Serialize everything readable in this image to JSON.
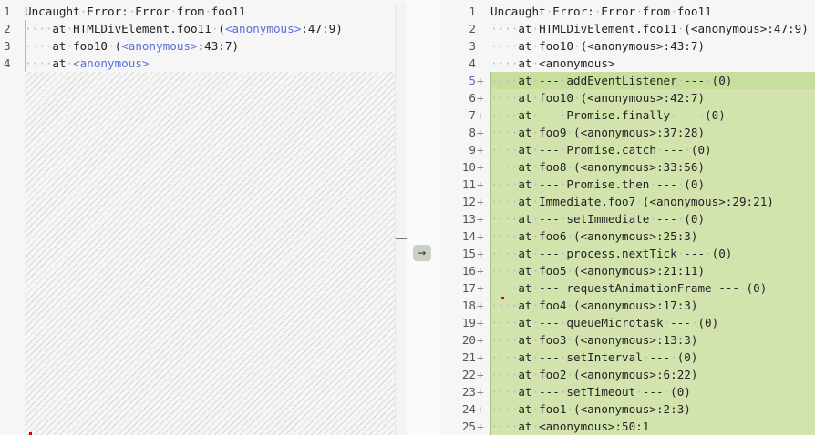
{
  "left": {
    "lines": [
      {
        "num": "1",
        "parts": [
          {
            "t": "Uncaught Error: Error from foo11"
          }
        ]
      },
      {
        "num": "2",
        "parts": [
          {
            "t": "    at HTMLDivElement.foo11 ("
          },
          {
            "t": "<anonymous>",
            "c": "anon"
          },
          {
            "t": ":47:9)"
          }
        ]
      },
      {
        "num": "3",
        "parts": [
          {
            "t": "    at foo10 ("
          },
          {
            "t": "<anonymous>",
            "c": "anon"
          },
          {
            "t": ":43:7)"
          }
        ]
      },
      {
        "num": "4",
        "parts": [
          {
            "t": "    at "
          },
          {
            "t": "<anonymous>",
            "c": "anon"
          }
        ]
      }
    ]
  },
  "middle": {
    "arrow_icon": "→"
  },
  "right": {
    "lines": [
      {
        "num": "1",
        "text": "Uncaught Error: Error from foo11"
      },
      {
        "num": "2",
        "text": "    at HTMLDivElement.foo11 (<anonymous>:47:9)"
      },
      {
        "num": "3",
        "text": "    at foo10 (<anonymous>:43:7)"
      },
      {
        "num": "4",
        "text": "    at <anonymous>"
      },
      {
        "num": "5",
        "added": true,
        "text": "    at --- addEventListener --- (0)"
      },
      {
        "num": "6",
        "added": true,
        "text": "    at foo10 (<anonymous>:42:7)"
      },
      {
        "num": "7",
        "added": true,
        "text": "    at --- Promise.finally --- (0)"
      },
      {
        "num": "8",
        "added": true,
        "text": "    at foo9 (<anonymous>:37:28)"
      },
      {
        "num": "9",
        "added": true,
        "text": "    at --- Promise.catch --- (0)"
      },
      {
        "num": "10",
        "added": true,
        "text": "    at foo8 (<anonymous>:33:56)"
      },
      {
        "num": "11",
        "added": true,
        "text": "    at --- Promise.then --- (0)"
      },
      {
        "num": "12",
        "added": true,
        "text": "    at Immediate.foo7 (<anonymous>:29:21)"
      },
      {
        "num": "13",
        "added": true,
        "text": "    at --- setImmediate --- (0)"
      },
      {
        "num": "14",
        "added": true,
        "text": "    at foo6 (<anonymous>:25:3)"
      },
      {
        "num": "15",
        "added": true,
        "text": "    at --- process.nextTick --- (0)"
      },
      {
        "num": "16",
        "added": true,
        "text": "    at foo5 (<anonymous>:21:11)"
      },
      {
        "num": "17",
        "added": true,
        "text": "    at --- requestAnimationFrame --- (0)"
      },
      {
        "num": "18",
        "added": true,
        "text": "    at foo4 (<anonymous>:17:3)"
      },
      {
        "num": "19",
        "added": true,
        "text": "    at --- queueMicrotask --- (0)"
      },
      {
        "num": "20",
        "added": true,
        "text": "    at foo3 (<anonymous>:13:3)"
      },
      {
        "num": "21",
        "added": true,
        "text": "    at --- setInterval --- (0)"
      },
      {
        "num": "22",
        "added": true,
        "text": "    at foo2 (<anonymous>:6:22)"
      },
      {
        "num": "23",
        "added": true,
        "text": "    at --- setTimeout --- (0)"
      },
      {
        "num": "24",
        "added": true,
        "text": "    at foo1 (<anonymous>:2:3)"
      },
      {
        "num": "25",
        "added": true,
        "text": "    at <anonymous>:50:1"
      }
    ],
    "plus_marker": "+"
  },
  "colors": {
    "added_bg": "#d3e3ae",
    "active_added_bg": "#c7df9c",
    "anon": "#5a6fd6"
  }
}
